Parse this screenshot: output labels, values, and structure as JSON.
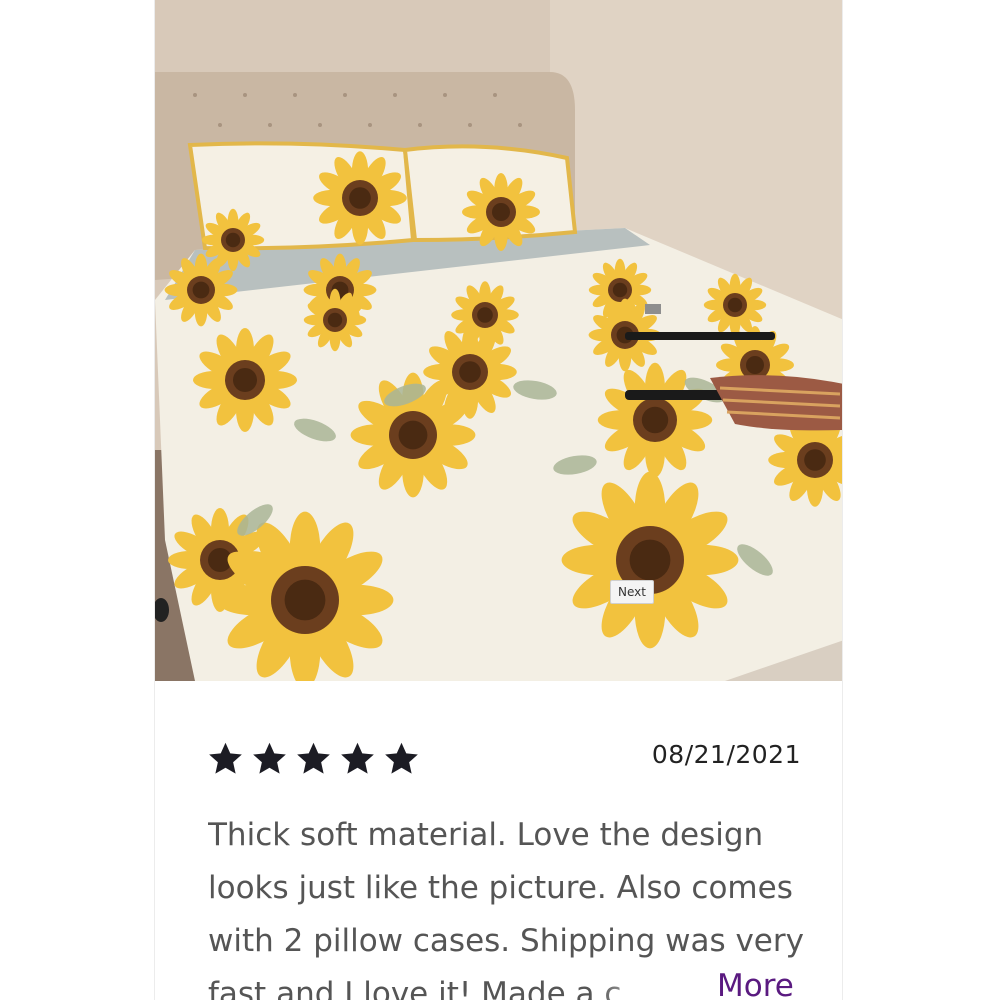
{
  "gallery": {
    "next_label": "Next",
    "image_alt": "Bed with sunflower print comforter and two pillowcases"
  },
  "review": {
    "rating": 5,
    "max_rating": 5,
    "date": "08/21/2021",
    "text": "Thick soft material. Love the design looks just like the picture. Also comes with 2 pillow cases. Shipping was very fast and I love it! Made a c",
    "more_label": "More"
  },
  "colors": {
    "star": "#1c1c24",
    "more_link": "#5a1a80",
    "sunflower_petal": "#f2c23e",
    "headboard": "#c9b7a3"
  },
  "icons": {
    "star": "star-icon"
  }
}
